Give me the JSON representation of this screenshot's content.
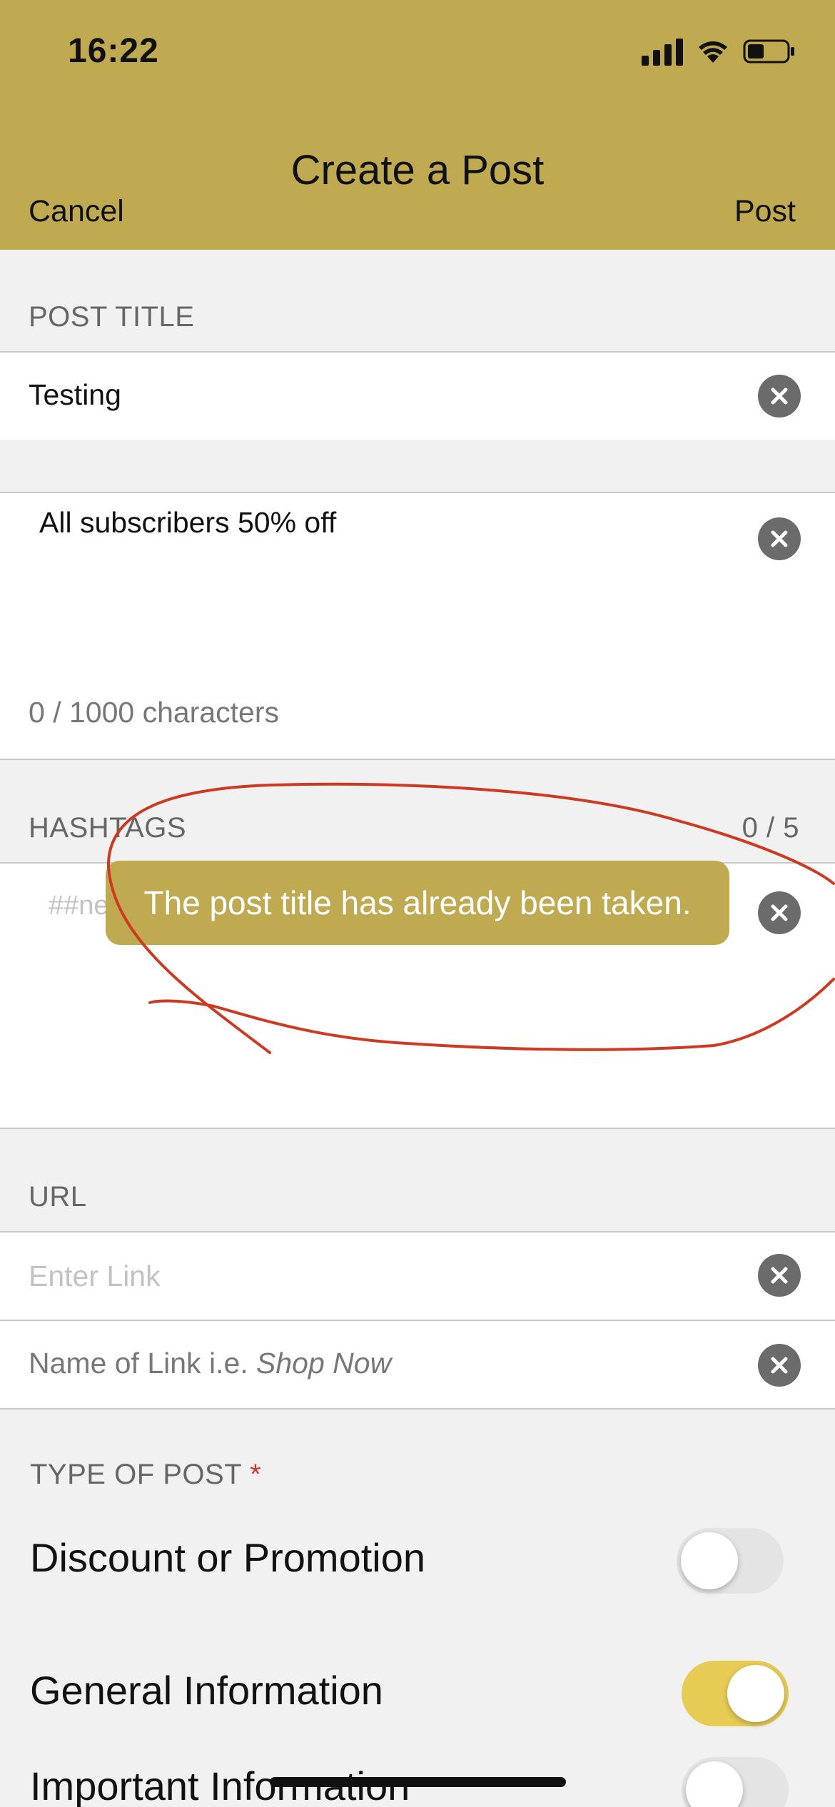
{
  "status_bar": {
    "time": "16:22",
    "icons": [
      "signal-icon",
      "wifi-icon",
      "battery-icon"
    ]
  },
  "nav": {
    "title": "Create a Post",
    "cancel_label": "Cancel",
    "post_label": "Post"
  },
  "post_title": {
    "section_label": "POST TITLE",
    "value": "Testing",
    "clear_icon": "clear-icon"
  },
  "description": {
    "value": "All subscribers 50% off",
    "char_count": "0 / 1000 characters"
  },
  "hashtags": {
    "section_label": "HASHTAGS",
    "count": "0 / 5",
    "placeholder_visible": "##ne"
  },
  "toast": {
    "message": "The post title has already been taken."
  },
  "url": {
    "section_label": "URL",
    "link_placeholder": "Enter Link",
    "name_placeholder_prefix": "Name of Link i.e. ",
    "name_placeholder_example": "Shop Now"
  },
  "type_of_post": {
    "section_label": "TYPE OF POST",
    "required_mark": "*",
    "options": [
      {
        "label": "Discount or Promotion",
        "enabled": false
      },
      {
        "label": "General Information",
        "enabled": true
      },
      {
        "label": "Important Information",
        "enabled": false
      }
    ]
  },
  "colors": {
    "brand": "#bfaa52",
    "toggle_on": "#e6cb55",
    "annotation": "#cc3a22"
  }
}
